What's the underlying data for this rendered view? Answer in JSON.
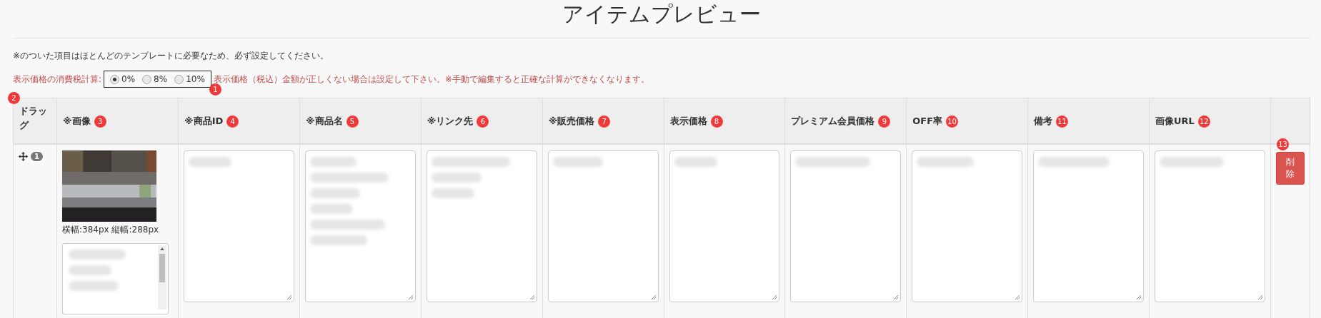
{
  "title": "アイテムプレビュー",
  "notice": "※のついた項目はほとんどのテンプレートに必要なため、必ず設定してください。",
  "tax": {
    "label": "表示価格の消費税計算:",
    "marker": "1",
    "hint": "表示価格（税込）金額が正しくない場合は設定して下さい。※手動で編集すると正確な計算ができなくなります。",
    "options": [
      {
        "label": "0%",
        "selected": true
      },
      {
        "label": "8%",
        "selected": false
      },
      {
        "label": "10%",
        "selected": false
      }
    ]
  },
  "table": {
    "columns": [
      {
        "kind": "drag",
        "label": "ドラッグ",
        "marker": "2"
      },
      {
        "label": "※画像",
        "marker": "3"
      },
      {
        "kind": "text",
        "label": "※商品ID",
        "marker": "4"
      },
      {
        "kind": "text",
        "label": "※商品名",
        "marker": "5"
      },
      {
        "kind": "text",
        "label": "※リンク先",
        "marker": "6"
      },
      {
        "kind": "text",
        "label": "※販売価格",
        "marker": "7"
      },
      {
        "kind": "text",
        "label": "表示価格",
        "marker": "8"
      },
      {
        "kind": "text",
        "label": "プレミアム会員価格",
        "marker": "9"
      },
      {
        "kind": "text",
        "label": "OFF率",
        "marker": "10"
      },
      {
        "kind": "text",
        "label": "備考",
        "marker": "11"
      },
      {
        "kind": "text",
        "label": "画像URL",
        "marker": "12"
      },
      {
        "kind": "action",
        "marker": "13"
      }
    ],
    "rows": [
      {
        "number": "1",
        "image_size": "横幅:384px 縦幅:288px",
        "delete_label": "削除"
      }
    ]
  }
}
